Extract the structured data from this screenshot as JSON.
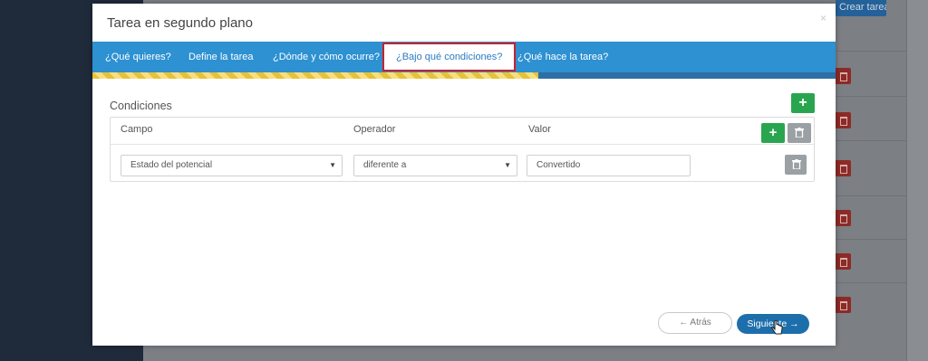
{
  "background": {
    "create_button_label": "Crear tarea"
  },
  "modal": {
    "title": "Tarea en segundo plano",
    "close_label": "×"
  },
  "tabs": [
    {
      "label": "¿Qué quieres?",
      "active": false
    },
    {
      "label": "Define la tarea",
      "active": false
    },
    {
      "label": "¿Dónde y cómo ocurre?",
      "active": false
    },
    {
      "label": "¿Bajo qué condiciones?",
      "active": true
    },
    {
      "label": "¿Qué hace la tarea?",
      "active": false
    }
  ],
  "progress": {
    "fraction": 0.6
  },
  "conditions": {
    "title": "Condiciones",
    "columns": {
      "field": "Campo",
      "operator": "Operador",
      "value": "Valor"
    },
    "rows": [
      {
        "field": "Estado del potencial",
        "operator": "diferente a",
        "value": "Convertido"
      }
    ]
  },
  "footer": {
    "back_label": "← Atrás",
    "next_label": "Siguiente →"
  },
  "icons": {
    "add": "plus-icon",
    "delete": "trash-icon",
    "dropdown": "caret-down-icon",
    "cursor": "hand-pointer-icon"
  },
  "colors": {
    "tab_bar": "#2d91d2",
    "active_tab_border": "#cc1f2b",
    "add_button": "#2aa54f",
    "next_button": "#1d6fab",
    "progress_stripe": "#e7c13a"
  }
}
